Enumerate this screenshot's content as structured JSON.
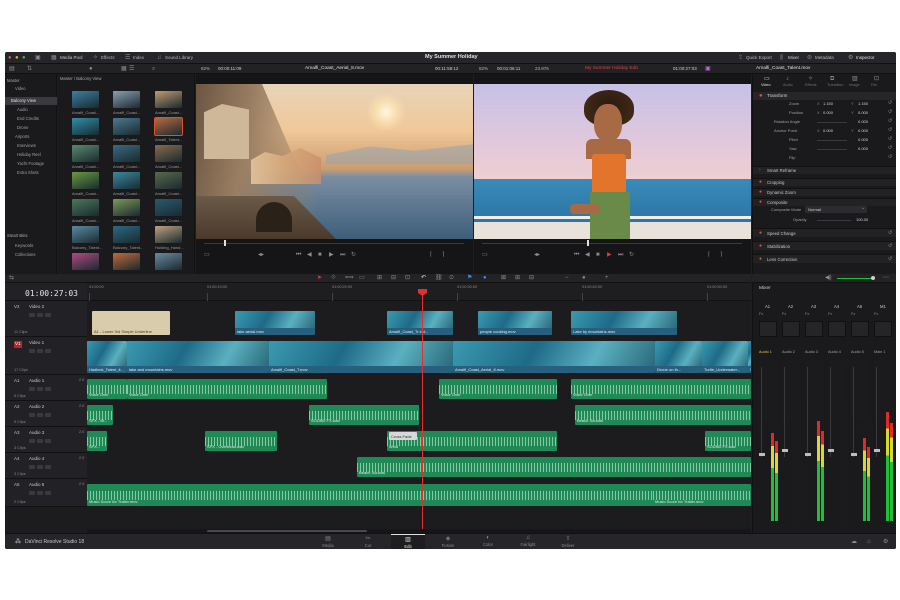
{
  "topbar": {
    "media_pool": "Media Pool",
    "effects": "Effects",
    "index": "Index",
    "sound_library": "Sound Library",
    "project_title": "My Summer Holiday",
    "quick_export": "Quick Export",
    "mixer": "Mixer",
    "metadata": "Metadata",
    "inspector": "Inspector"
  },
  "viewer_bar": {
    "left_zoom": "82%",
    "left_timecode": "00:00:11:09",
    "left_clip": "Amalfi_Coast_Aerial_8.mov",
    "left_duration": "00:11:58:12",
    "right_zoom": "82%",
    "right_timecode": "00:01:06:11",
    "right_zoom2": "23.976",
    "timeline_name": "My Summer Holiday Edit",
    "right_tc": "01:00:27:03",
    "inspector_clip": "Amalfi_Coast_Talent.mov"
  },
  "media_pool": {
    "sidebar_header": "Master",
    "bins": [
      "Master",
      "Video",
      "Balcony View",
      "Audio",
      "End Credits",
      "Drone",
      "Airports",
      "Interviews",
      "Holiday Reel",
      "Yacht Footage",
      "Extra Shots"
    ],
    "smart_bins_header": "Smart Bins",
    "smart_bins": [
      "Keywords",
      "Collections"
    ],
    "grid_header": "Master / Balcony View",
    "clips": [
      {
        "label": "Amalfi_Coast...",
        "color": "#3d7fa0"
      },
      {
        "label": "Amalfi_Coast...",
        "color": "#8a9fb0"
      },
      {
        "label": "Amalfi_Coast...",
        "color": "#c09a70"
      },
      {
        "label": "Amalfi_Coast...",
        "color": "#2f8fa8"
      },
      {
        "label": "Amalfi_Coast...",
        "color": "#4a7a90"
      },
      {
        "label": "Amalfi_Talent...",
        "color": "#b86a40"
      },
      {
        "label": "Amalfi_Coast...",
        "color": "#5a8a70"
      },
      {
        "label": "Amalfi_Coast...",
        "color": "#3a6a80"
      },
      {
        "label": "Amalfi_Coast...",
        "color": "#8a6a50"
      },
      {
        "label": "Amalfi_Coast...",
        "color": "#6a9a40"
      },
      {
        "label": "Amalfi_Coast...",
        "color": "#3a8aa0"
      },
      {
        "label": "Amalfi_Coast...",
        "color": "#5a6a4a"
      },
      {
        "label": "Amalfi_Coast...",
        "color": "#4a7a5a"
      },
      {
        "label": "Amalfi_Coast...",
        "color": "#7a9a5a"
      },
      {
        "label": "Amalfi_Coast...",
        "color": "#2a5a70"
      },
      {
        "label": "Balcony_Talent...",
        "color": "#5a8aa0"
      },
      {
        "label": "Balcony_Talent...",
        "color": "#2a6a80"
      },
      {
        "label": "Holding_Hand...",
        "color": "#c0a080"
      },
      {
        "label": "",
        "color": "#b04a80"
      },
      {
        "label": "",
        "color": "#c06a3a"
      },
      {
        "label": "",
        "color": "#6a8aa0"
      }
    ]
  },
  "inspector": {
    "tabs": [
      "Video",
      "Audio",
      "Effects",
      "Transition",
      "Image",
      "File"
    ],
    "transform_header": "Transform",
    "rows": [
      {
        "label": "Zoom",
        "x_label": "X",
        "x": "1.150",
        "y_label": "Y",
        "y": "1.150"
      },
      {
        "label": "Position",
        "x_label": "X",
        "x": "0.000",
        "y_label": "Y",
        "y": "0.000"
      },
      {
        "label": "Rotation Angle",
        "x_label": "",
        "x": "",
        "y_label": "",
        "y": "0.000"
      },
      {
        "label": "Anchor Point",
        "x_label": "X",
        "x": "0.000",
        "y_label": "Y",
        "y": "0.000"
      },
      {
        "label": "Pitch",
        "x_label": "",
        "x": "",
        "y_label": "",
        "y": "0.000"
      },
      {
        "label": "Yaw",
        "x_label": "",
        "x": "",
        "y_label": "",
        "y": "0.000"
      },
      {
        "label": "Flip",
        "x_label": "",
        "x": "",
        "y_label": "",
        "y": ""
      }
    ],
    "sections": [
      "Smart Reframe",
      "Cropping",
      "Dynamic Zoom",
      "Composite"
    ],
    "composite_mode_label": "Composite Mode",
    "composite_mode_value": "Normal",
    "opacity_label": "Opacity",
    "opacity_value": "100.00",
    "more_sections": [
      "Speed Change",
      "Stabilization",
      "Lens Correction"
    ]
  },
  "timeline": {
    "timecode": "01:00:27:03",
    "ruler": [
      "01:00:00",
      "01:00:10:00",
      "01:00:20:00",
      "01:00:30:00",
      "01:00:40:00",
      "01:00:50:00",
      "01:01:00:00"
    ],
    "tracks": [
      {
        "id": "V2",
        "name": "Video 2",
        "clips_count": "11 Clips"
      },
      {
        "id": "V1",
        "name": "Video 1",
        "clips_count": "17 Clips"
      },
      {
        "id": "A1",
        "name": "Audio 1",
        "level": "2.0",
        "clips_count": "6 Clips"
      },
      {
        "id": "A2",
        "name": "Audio 2",
        "level": "2.0",
        "clips_count": "5 Clips"
      },
      {
        "id": "A3",
        "name": "Audio 3",
        "level": "2.0",
        "clips_count": "3 Clips"
      },
      {
        "id": "A4",
        "name": "Audio 4",
        "level": "2.0",
        "clips_count": "3 Clips"
      },
      {
        "id": "A5",
        "name": "Audio 5",
        "level": "2.0",
        "clips_count": "2 Clips"
      }
    ],
    "v2_clips": [
      "A1 - Lower 3rd Simple Underline",
      "lake aerial.mov",
      "Amalfi_Coast_Tr.est...",
      "people cooking.mov",
      "Lake by mountains.mov"
    ],
    "v1_clips": [
      "Hadleck_Talent_li...",
      "lake and mountains.mov",
      "Amalfi_Coast_T.mov",
      "Amalfi_Coast_Aerial_8.mov",
      "Drone on th...",
      "Turtle_Underwater...",
      "Su..."
    ],
    "a1_clips": [
      "Voice Over",
      "Voice Over",
      "Voice Over",
      "Voice Over"
    ],
    "a2_clips": [
      "SFX - Bi...",
      "SOUND FX.wav",
      "Beach Sounds"
    ],
    "a3_clips": [
      "SFX...",
      "SFX - Overhead.wav",
      "Wind",
      "Cross Fade",
      "SOUND FX.wav"
    ],
    "a4_clips": [
      "Beach Sounds"
    ],
    "a5_clips": [
      "Music Score for Trailer.mov",
      "Music Score for Trailer.mov"
    ]
  },
  "mixer": {
    "title": "Mixer",
    "channels": [
      "A1",
      "A2",
      "A3",
      "A4",
      "A5",
      "M1"
    ],
    "strip_labels": [
      "Audio 1",
      "Audio 2",
      "Audio 3",
      "Audio 4",
      "Audio 5",
      "Main 1"
    ],
    "fx_label": "Fx"
  },
  "bottom": {
    "app_name": "DaVinci Resolve Studio 18",
    "pages": [
      "Media",
      "Cut",
      "Edit",
      "Fusion",
      "Color",
      "Fairlight",
      "Deliver"
    ]
  },
  "colors": {
    "audio_clip": "#1f8a55",
    "video_clip": "#2a5f7f",
    "playhead": "#e03030",
    "accent": "#c0392b"
  }
}
